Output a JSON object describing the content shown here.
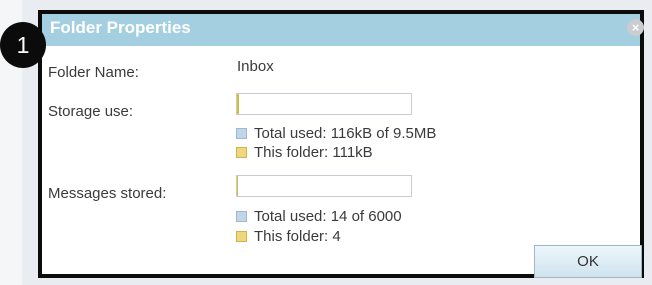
{
  "dialog": {
    "title": "Folder Properties",
    "close_glyph": "×",
    "step_number": "1"
  },
  "folder": {
    "name_label": "Folder Name:",
    "name_value": "Inbox"
  },
  "storage": {
    "label": "Storage use:",
    "fill_percent": 1.2,
    "legend": [
      {
        "text": "Total used: 116kB of 9.5MB",
        "swatch": "#c2d6ea"
      },
      {
        "text": "This folder: 111kB",
        "swatch": "#efd77f"
      }
    ]
  },
  "messages": {
    "label": "Messages stored:",
    "fill_percent": 0.5,
    "legend": [
      {
        "text": "Total used: 14 of 6000",
        "swatch": "#c2d6ea"
      },
      {
        "text": "This folder: 4",
        "swatch": "#efd77f"
      }
    ]
  },
  "buttons": {
    "ok_label": "OK"
  },
  "colors": {
    "titlebar": "#a3cfe0",
    "usage_fill": "#d9b93a",
    "highlight_border": "#0b0b0b"
  },
  "icons": {
    "close": "close-icon",
    "legend_total": "legend-total-swatch-icon",
    "legend_folder": "legend-folder-swatch-icon"
  }
}
